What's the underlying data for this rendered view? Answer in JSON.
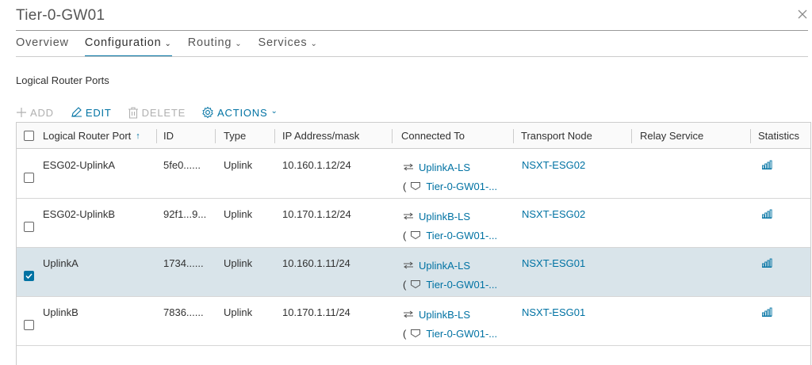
{
  "window": {
    "title": "Tier-0-GW01",
    "close_label": "close"
  },
  "tabs": [
    {
      "label": "Overview",
      "active": false,
      "dropdown": false
    },
    {
      "label": "Configuration",
      "active": true,
      "dropdown": true
    },
    {
      "label": "Routing",
      "active": false,
      "dropdown": true
    },
    {
      "label": "Services",
      "active": false,
      "dropdown": true
    }
  ],
  "section": {
    "title": "Logical Router Ports"
  },
  "toolbar": {
    "add": "ADD",
    "edit": "EDIT",
    "delete": "DELETE",
    "actions": "ACTIONS"
  },
  "table": {
    "columns": [
      "Logical Router Port",
      "ID",
      "Type",
      "IP Address/mask",
      "Connected To",
      "Transport Node",
      "Relay Service",
      "Statistics"
    ],
    "sort_indicator": "↑",
    "rows": [
      {
        "selected": false,
        "name": "ESG02-UplinkA",
        "id": "5fe0......",
        "type": "Uplink",
        "ip": "10.160.1.12/24",
        "switch": "UplinkA-LS",
        "router": "Tier-0-GW01-...",
        "node": "NSXT-ESG02",
        "relay": ""
      },
      {
        "selected": false,
        "name": "ESG02-UplinkB",
        "id": "92f1...9...",
        "type": "Uplink",
        "ip": "10.170.1.12/24",
        "switch": "UplinkB-LS",
        "router": "Tier-0-GW01-...",
        "node": "NSXT-ESG02",
        "relay": ""
      },
      {
        "selected": true,
        "name": "UplinkA",
        "id": "1734......",
        "type": "Uplink",
        "ip": "10.160.1.11/24",
        "switch": "UplinkA-LS",
        "router": "Tier-0-GW01-...",
        "node": "NSXT-ESG01",
        "relay": ""
      },
      {
        "selected": false,
        "name": "UplinkB",
        "id": "7836......",
        "type": "Uplink",
        "ip": "10.170.1.11/24",
        "switch": "UplinkB-LS",
        "router": "Tier-0-GW01-...",
        "node": "NSXT-ESG01",
        "relay": ""
      }
    ]
  },
  "colors": {
    "accent": "#0072a3",
    "selected_row": "#d9e4ea",
    "disabled": "#b0b0b0"
  }
}
